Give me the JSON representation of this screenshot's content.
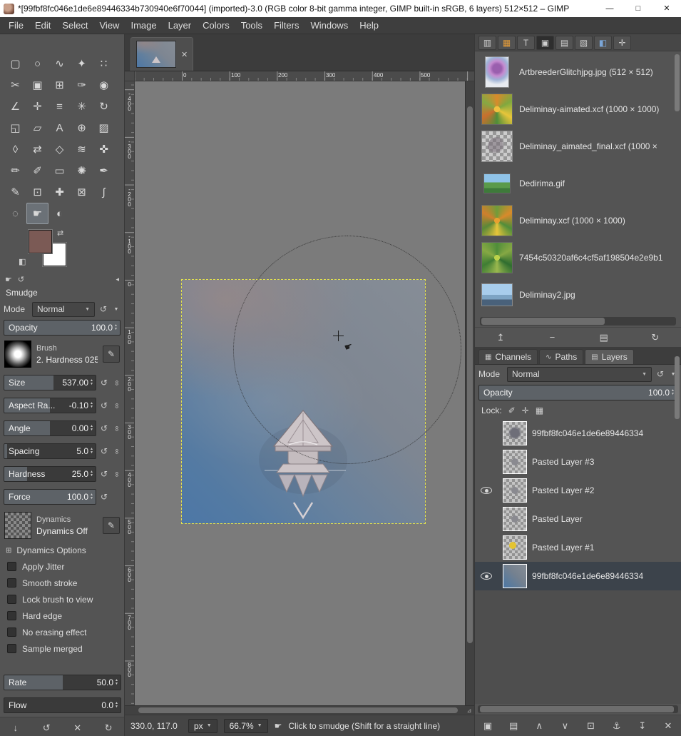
{
  "window": {
    "title": "*[99fbf8fc046e1de6e89446334b730940e6f70044] (imported)-3.0 (RGB color 8-bit gamma integer, GIMP built-in sRGB, 6 layers) 512×512 – GIMP",
    "minimize": "—",
    "maximize": "□",
    "close": "✕"
  },
  "menu": [
    "File",
    "Edit",
    "Select",
    "View",
    "Image",
    "Layer",
    "Colors",
    "Tools",
    "Filters",
    "Windows",
    "Help"
  ],
  "icons": {
    "reset": "↺",
    "chain": "∞",
    "caret": "▼",
    "spin_up": "▲",
    "spin_down": "▼",
    "dock_menu": "◂",
    "close": "✕",
    "expander": "⊞",
    "edit": "✎",
    "swap": "⇄",
    "default_colors": "◧",
    "smudge_cursor": "☛",
    "nav": "⊿"
  },
  "colors": {
    "foreground": "#7b5a55",
    "background": "#ffffff",
    "fg_style": "background:#7b5a55",
    "bg_style": "background:#ffffff",
    "layer_boundary": "#e3e34d",
    "canvas_blue": "#4d77a6"
  },
  "toolbox": {
    "tools": [
      {
        "name": "tool-rectangle-select",
        "glyph": "▢"
      },
      {
        "name": "tool-ellipse-select",
        "glyph": "○"
      },
      {
        "name": "tool-free-select",
        "glyph": "∿"
      },
      {
        "name": "tool-fuzzy-select",
        "glyph": "✦"
      },
      {
        "name": "tool-select-by-color",
        "glyph": "∷"
      },
      {
        "name": "tool-scissors-select",
        "glyph": "✂"
      },
      {
        "name": "tool-foreground-select",
        "glyph": "▣"
      },
      {
        "name": "tool-crop",
        "glyph": "⊞"
      },
      {
        "name": "tool-color-picker",
        "glyph": "✑"
      },
      {
        "name": "tool-zoom",
        "glyph": "◉"
      },
      {
        "name": "tool-measure",
        "glyph": "∠"
      },
      {
        "name": "tool-move",
        "glyph": "✛"
      },
      {
        "name": "tool-align",
        "glyph": "≡"
      },
      {
        "name": "tool-unified-transform",
        "glyph": "✳"
      },
      {
        "name": "tool-rotate",
        "glyph": "↻"
      },
      {
        "name": "tool-scale",
        "glyph": "◱"
      },
      {
        "name": "tool-shear",
        "glyph": "▱"
      },
      {
        "name": "tool-text",
        "glyph": "A"
      },
      {
        "name": "tool-bucket-fill",
        "glyph": "⊕"
      },
      {
        "name": "tool-gradient",
        "glyph": "▨"
      },
      {
        "name": "tool-perspective",
        "glyph": "◊"
      },
      {
        "name": "tool-flip",
        "glyph": "⇄"
      },
      {
        "name": "tool-cage-transform",
        "glyph": "◇"
      },
      {
        "name": "tool-warp-transform",
        "glyph": "≋"
      },
      {
        "name": "tool-handle-transform",
        "glyph": "✜"
      },
      {
        "name": "tool-pencil",
        "glyph": "✏"
      },
      {
        "name": "tool-paintbrush",
        "glyph": "✐"
      },
      {
        "name": "tool-eraser",
        "glyph": "▭"
      },
      {
        "name": "tool-airbrush",
        "glyph": "✺"
      },
      {
        "name": "tool-ink",
        "glyph": "✒"
      },
      {
        "name": "tool-mypaint-brush",
        "glyph": "✎"
      },
      {
        "name": "tool-clone",
        "glyph": "⊡"
      },
      {
        "name": "tool-heal",
        "glyph": "✚"
      },
      {
        "name": "tool-perspective-clone",
        "glyph": "⊠"
      },
      {
        "name": "tool-paths",
        "glyph": "∫"
      },
      {
        "name": "tool-blur-sharpen",
        "glyph": "◌"
      },
      {
        "name": "tool-smudge",
        "glyph": "☛",
        "cls": "selected"
      },
      {
        "name": "tool-dodge-burn",
        "glyph": "◐"
      }
    ],
    "footer": [
      {
        "name": "save-tool-preset-button",
        "glyph": "↓"
      },
      {
        "name": "restore-tool-preset-button",
        "glyph": "↺"
      },
      {
        "name": "delete-tool-preset-button",
        "glyph": "✕"
      },
      {
        "name": "reset-tool-options-button",
        "glyph": "↻"
      }
    ]
  },
  "tool_options": {
    "title": "Smudge",
    "mode_label": "Mode",
    "mode_value": "Normal",
    "opacity": {
      "label": "Opacity",
      "value": "100.0",
      "fill": "100%"
    },
    "brush_label": "Brush",
    "brush_name": "2. Hardness 025",
    "sliders": [
      {
        "name": "size-slider",
        "label": "Size",
        "value": "537.00",
        "fill": "54%",
        "chain": "chain-on"
      },
      {
        "name": "aspect-ratio-slider",
        "label": "Aspect Ra...",
        "value": "-0.10",
        "fill": "50%",
        "chain": "chain-on"
      },
      {
        "name": "angle-slider",
        "label": "Angle",
        "value": "0.00",
        "fill": "50%",
        "chain": "chain-on"
      },
      {
        "name": "spacing-slider",
        "label": "Spacing",
        "value": "5.0",
        "fill": "3%",
        "chain": "chain-on"
      },
      {
        "name": "hardness-slider",
        "label": "Hardness",
        "value": "25.0",
        "fill": "25%",
        "chain": "chain-on"
      },
      {
        "name": "force-slider",
        "label": "Force",
        "value": "100.0",
        "fill": "100%",
        "chain": "chain-off"
      }
    ],
    "dynamics_label": "Dynamics",
    "dynamics_value": "Dynamics Off",
    "dynamics_options_label": "Dynamics Options",
    "checkboxes": [
      {
        "name": "apply-jitter-checkbox",
        "label": "Apply Jitter"
      },
      {
        "name": "smooth-stroke-checkbox",
        "label": "Smooth stroke"
      },
      {
        "name": "lock-brush-to-view-checkbox",
        "label": "Lock brush to view"
      },
      {
        "name": "hard-edge-checkbox",
        "label": "Hard edge"
      },
      {
        "name": "no-erasing-effect-checkbox",
        "label": "No erasing effect"
      },
      {
        "name": "sample-merged-checkbox",
        "label": "Sample merged"
      }
    ],
    "rate": {
      "label": "Rate",
      "value": "50.0",
      "fill": "50%"
    },
    "flow": {
      "label": "Flow",
      "value": "0.0",
      "fill": "0%"
    }
  },
  "canvas": {
    "ruler_h": [
      {
        "t": "0",
        "pos": "66px"
      },
      {
        "t": "100",
        "pos": "133px"
      },
      {
        "t": "200",
        "pos": "199px"
      },
      {
        "t": "300",
        "pos": "266px"
      },
      {
        "t": "400",
        "pos": "333px"
      },
      {
        "t": "500",
        "pos": "399px"
      }
    ],
    "ruler_v": [
      {
        "t": "-400",
        "pos": "11px"
      },
      {
        "t": "-300",
        "pos": "78px"
      },
      {
        "t": "-200",
        "pos": "145px"
      },
      {
        "t": "-100",
        "pos": "211px"
      },
      {
        "t": "0",
        "pos": "278px"
      },
      {
        "t": "100",
        "pos": "345px"
      },
      {
        "t": "200",
        "pos": "411px"
      },
      {
        "t": "300",
        "pos": "478px"
      },
      {
        "t": "400",
        "pos": "545px"
      },
      {
        "t": "500",
        "pos": "611px"
      },
      {
        "t": "600",
        "pos": "678px"
      },
      {
        "t": "700",
        "pos": "745px"
      },
      {
        "t": "800",
        "pos": "811px"
      }
    ],
    "statusbar": {
      "position": "330.0, 117.0",
      "unit": "px",
      "zoom": "66.7%",
      "hint": "Click to smudge (Shift for a straight line)"
    }
  },
  "images_dock": {
    "tabs": [
      {
        "name": "dock-tab-brushes",
        "glyph": "▥"
      },
      {
        "name": "dock-tab-patterns",
        "glyph": "▦",
        "cls": "tab-orange"
      },
      {
        "name": "dock-tab-fonts",
        "glyph": "T"
      },
      {
        "name": "dock-tab-images",
        "glyph": "▣",
        "cls": "selected"
      },
      {
        "name": "dock-tab-document-history",
        "glyph": "▤"
      },
      {
        "name": "dock-tab-palettes",
        "glyph": "▧"
      },
      {
        "name": "dock-tab-gradients",
        "glyph": "◧",
        "cls": "tab-blue"
      },
      {
        "name": "dock-tab-tool-presets",
        "glyph": "✛"
      }
    ],
    "items": [
      {
        "label": "ArtbreederGlitchjpg.jpg (512 × 512)",
        "thumb": "thumb-artbreeder"
      },
      {
        "label": "Deliminay-aimated.xcf (1000 × 1000)",
        "thumb": "thumb-kaleido1"
      },
      {
        "label": "Deliminay_aimated_final.xcf (1000 ×",
        "thumb": "thumb-checker"
      },
      {
        "label": "Dedirima.gif",
        "thumb": "thumb-landscape"
      },
      {
        "label": "Deliminay.xcf (1000 × 1000)",
        "thumb": "thumb-kaleido2"
      },
      {
        "label": "7454c50320af6c4cf5af198504e2e9b1",
        "thumb": "thumb-kaleido3"
      },
      {
        "label": "Deliminay2.jpg",
        "thumb": "thumb-sky"
      }
    ],
    "buttons": [
      {
        "name": "raise-displays-button",
        "glyph": "↥"
      },
      {
        "name": "remove-image-button",
        "glyph": "−"
      },
      {
        "name": "new-display-button",
        "glyph": "▤"
      },
      {
        "name": "refresh-button",
        "glyph": "↻"
      }
    ]
  },
  "layers_dock": {
    "tabs": [
      {
        "name": "tab-channels",
        "label": "Channels",
        "glyph": "▦",
        "cls": ""
      },
      {
        "name": "tab-paths",
        "label": "Paths",
        "glyph": "∿",
        "cls": ""
      },
      {
        "name": "tab-layers",
        "label": "Layers",
        "glyph": "▤",
        "cls": "selected"
      }
    ],
    "mode_label": "Mode",
    "mode_value": "Normal",
    "opacity": {
      "label": "Opacity",
      "value": "100.0",
      "fill": "100%"
    },
    "lock_label": "Lock:",
    "lock_buttons": [
      {
        "name": "lock-pixels-button",
        "glyph": "✐"
      },
      {
        "name": "lock-position-button",
        "glyph": "✛"
      },
      {
        "name": "lock-alpha-button",
        "glyph": "▦"
      }
    ],
    "layers": [
      {
        "label": "99fbf8fc046e1de6e89446334",
        "eye": "off",
        "thumb": "lthumb-figure",
        "cls": ""
      },
      {
        "label": "Pasted Layer #3",
        "eye": "off",
        "thumb": "lthumb-mark",
        "cls": ""
      },
      {
        "label": "Pasted Layer #2",
        "eye": "on",
        "thumb": "lthumb-mark",
        "cls": ""
      },
      {
        "label": "Pasted Layer",
        "eye": "off",
        "thumb": "lthumb-mark",
        "cls": ""
      },
      {
        "label": "Pasted Layer #1",
        "eye": "off",
        "thumb": "lthumb-dot",
        "cls": ""
      },
      {
        "label": "99fbf8fc046e1de6e89446334",
        "eye": "on",
        "thumb": "lthumb-canvas",
        "cls": "selected"
      }
    ],
    "footer": [
      {
        "name": "new-layer-button",
        "glyph": "▣"
      },
      {
        "name": "new-group-button",
        "glyph": "▤"
      },
      {
        "name": "raise-layer-button",
        "glyph": "∧"
      },
      {
        "name": "lower-layer-button",
        "glyph": "∨"
      },
      {
        "name": "duplicate-layer-button",
        "glyph": "⊡"
      },
      {
        "name": "anchor-layer-button",
        "glyph": "⚓"
      },
      {
        "name": "merge-down-button",
        "glyph": "↧"
      },
      {
        "name": "delete-layer-button",
        "glyph": "✕"
      }
    ]
  }
}
